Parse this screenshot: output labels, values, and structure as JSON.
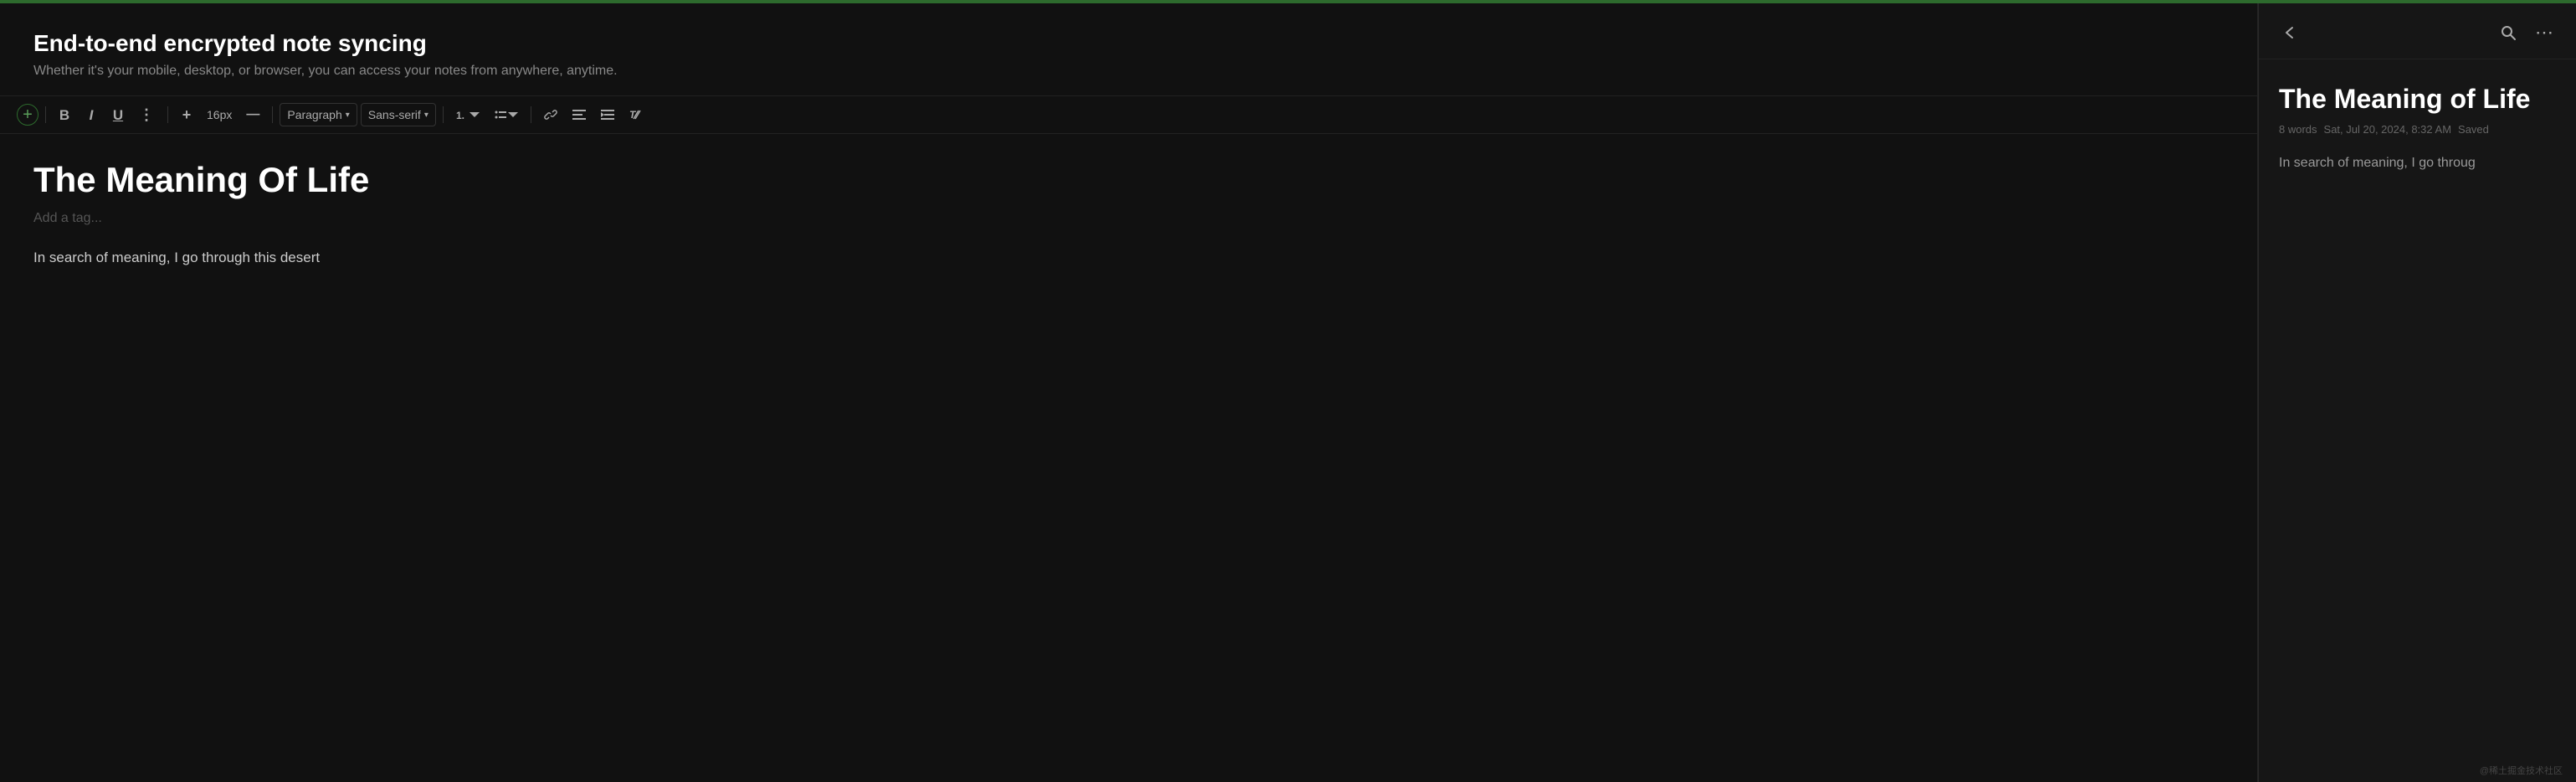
{
  "app": {
    "top_bar_color": "#2d6a2d"
  },
  "banner": {
    "title": "End-to-end encrypted note syncing",
    "subtitle": "Whether it's your mobile, desktop, or browser, you can access your notes from anywhere, anytime."
  },
  "toolbar": {
    "add_label": "+",
    "bold_label": "B",
    "italic_label": "I",
    "underline_label": "U",
    "more_label": "⋮",
    "insert_label": "+",
    "font_size_label": "16px",
    "dash_label": "—",
    "paragraph_label": "Paragraph",
    "font_label": "Sans-serif",
    "ordered_list_label": "ordered-list",
    "unordered_list_label": "unordered-list",
    "link_label": "link",
    "align_label": "align",
    "indent_label": "indent",
    "clear_label": "clear-format"
  },
  "editor": {
    "title": "The Meaning Of Life",
    "tag_placeholder": "Add a tag...",
    "body": "In search of meaning, I go through this desert"
  },
  "preview": {
    "back_icon": "←",
    "search_icon": "search",
    "more_icon": "⋯",
    "note_title": "The Meaning of Life",
    "meta": {
      "words": "8 words",
      "date": "Sat, Jul 20, 2024, 8:32 AM",
      "saved": "Saved"
    },
    "body_preview": "In search of meaning, I go throug"
  },
  "footer": {
    "text": "@稀土掘金技术社区"
  }
}
